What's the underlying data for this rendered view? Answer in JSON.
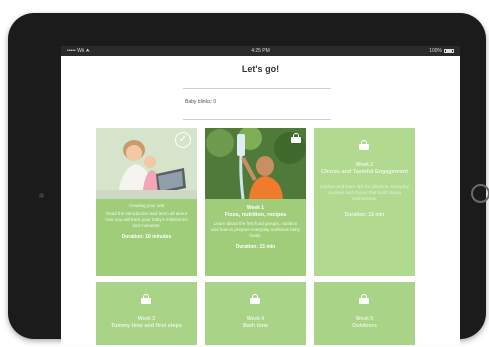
{
  "status": {
    "carrier": "••••• Wii ⮝",
    "time": "4:25 PM",
    "battery": "100%"
  },
  "header": {
    "title": "Let's go!",
    "baby_info": "Baby blinks: 0"
  },
  "cards": [
    {
      "week": "",
      "title": "Creating your unit",
      "desc": "Read the introduction and learn all about how you will track your baby's milestones and moments.",
      "duration": "Duration: 10 minutes",
      "state": "done"
    },
    {
      "week": "Week 1",
      "title": "Fixes, nutrition, recipes",
      "desc": "Learn about the first food groups, nutrition and how to prepare everyday nutritious baby foods.",
      "duration": "Duration: 15 min",
      "state": "locked"
    },
    {
      "week": "Week 2",
      "title": "Chores and Tasteful Engagement",
      "desc": "Explore and learn tips for playtime, everyday routines and chores that build strong connections.",
      "duration": "Duration: 15 min",
      "state": "locked"
    },
    {
      "week": "Week 3",
      "title": "Tummy time and first steps",
      "desc": "",
      "duration": "",
      "state": "locked"
    },
    {
      "week": "Week 4",
      "title": "Bath time",
      "desc": "",
      "duration": "",
      "state": "locked"
    },
    {
      "week": "Week 5",
      "title": "Outdoors",
      "desc": "",
      "duration": "",
      "state": "locked"
    }
  ],
  "colors": {
    "card_green": "#9fcd79",
    "accent": "#6fb33f"
  }
}
